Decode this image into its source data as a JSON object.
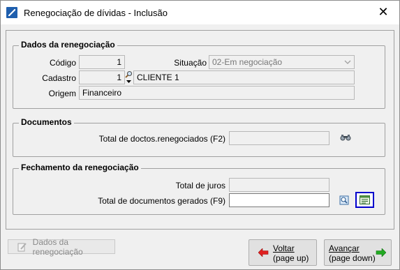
{
  "window": {
    "title": "Renegociação de dívidas - Inclusão",
    "close_glyph": "✕"
  },
  "dados": {
    "title": "Dados da renegociação",
    "codigo_label": "Código",
    "codigo_value": "1",
    "situacao_label": "Situação",
    "situacao_value": "02-Em negociação",
    "cadastro_label": "Cadastro",
    "cadastro_value": "1",
    "cliente_value": "CLIENTE 1",
    "origem_label": "Origem",
    "origem_value": "Financeiro"
  },
  "documentos": {
    "title": "Documentos",
    "total_label": "Total de doctos.renegociados (F2)",
    "total_value": ""
  },
  "fechamento": {
    "title": "Fechamento da renegociação",
    "juros_label": "Total de juros",
    "juros_value": "",
    "gerados_label": "Total de documentos gerados (F9)",
    "gerados_value": ""
  },
  "footer": {
    "dados_button_label": "Dados da renegociação",
    "voltar_label": "Voltar",
    "voltar_hint": "(page up)",
    "avancar_label": "Avançar",
    "avancar_hint": "(page down)"
  },
  "icons": {
    "app": "app-logo-icon",
    "search": "magnifier-icon",
    "binoculars": "binoculars-icon",
    "view": "view-document-icon",
    "list": "document-list-icon",
    "back": "left-arrow-icon",
    "forward": "right-arrow-icon",
    "edit": "edit-document-icon"
  },
  "colors": {
    "focus_border": "#0000cc",
    "back_arrow": "#e02020",
    "forward_arrow": "#22aa22"
  }
}
